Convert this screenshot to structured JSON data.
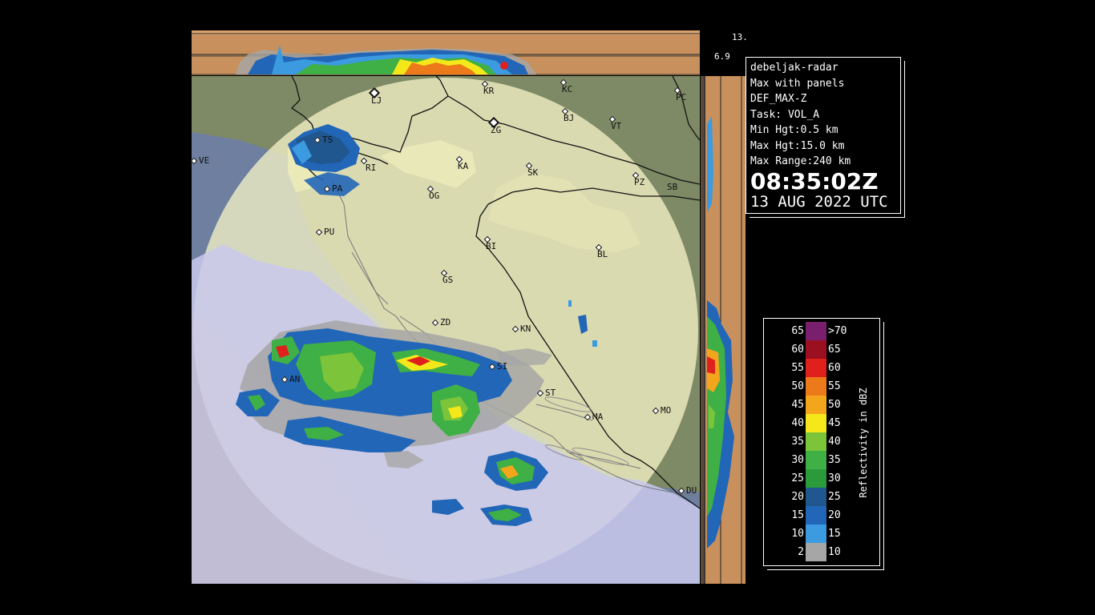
{
  "height_labels": {
    "top": "13.",
    "mid": "6.9"
  },
  "info": {
    "site": "debeljak-radar",
    "product": "Max with panels",
    "config": "DEF_MAX-Z",
    "task": "Task: VOL_A",
    "min_hgt": "Min Hgt:0.5 km",
    "max_hgt": "Max Hgt:15.0 km",
    "max_range": "Max Range:240 km",
    "time": "08:35:02Z",
    "date": "13 AUG 2022 UTC"
  },
  "legend": {
    "title": "Reflectivity in dBZ",
    "rows": [
      {
        "lo": "65",
        "hi": ">70",
        "color": "#7a1f6e"
      },
      {
        "lo": "60",
        "hi": "65",
        "color": "#9b1020"
      },
      {
        "lo": "55",
        "hi": "60",
        "color": "#e0201c"
      },
      {
        "lo": "50",
        "hi": "55",
        "color": "#ec7a1a"
      },
      {
        "lo": "45",
        "hi": "50",
        "color": "#f3a51c"
      },
      {
        "lo": "40",
        "hi": "45",
        "color": "#f4e81a"
      },
      {
        "lo": "35",
        "hi": "40",
        "color": "#7cc43a"
      },
      {
        "lo": "30",
        "hi": "35",
        "color": "#3fb045"
      },
      {
        "lo": "25",
        "hi": "30",
        "color": "#2b9a3a"
      },
      {
        "lo": "20",
        "hi": "25",
        "color": "#21578f"
      },
      {
        "lo": "15",
        "hi": "20",
        "color": "#2266b8"
      },
      {
        "lo": "10",
        "hi": "15",
        "color": "#3c9be0"
      },
      {
        "lo": "2",
        "hi": "10",
        "color": "#a6a6a6"
      }
    ]
  },
  "cities": [
    {
      "id": "lj",
      "label": "LJ",
      "big": true
    },
    {
      "id": "kr",
      "label": "KR"
    },
    {
      "id": "kc",
      "label": "KC"
    },
    {
      "id": "pc",
      "label": "PC"
    },
    {
      "id": "bj",
      "label": "BJ"
    },
    {
      "id": "vt",
      "label": "VT"
    },
    {
      "id": "zg",
      "label": "ZG",
      "big": true
    },
    {
      "id": "ts",
      "label": "TS"
    },
    {
      "id": "ve",
      "label": "VE"
    },
    {
      "id": "ri",
      "label": "RI"
    },
    {
      "id": "ka",
      "label": "KA"
    },
    {
      "id": "sk",
      "label": "SK"
    },
    {
      "id": "pz",
      "label": "PZ"
    },
    {
      "id": "sb",
      "label": "SB"
    },
    {
      "id": "pa",
      "label": "PA"
    },
    {
      "id": "og",
      "label": "OG"
    },
    {
      "id": "pu",
      "label": "PU"
    },
    {
      "id": "bi",
      "label": "BI"
    },
    {
      "id": "bl",
      "label": "BL"
    },
    {
      "id": "gs",
      "label": "GS"
    },
    {
      "id": "zd",
      "label": "ZD"
    },
    {
      "id": "kn",
      "label": "KN"
    },
    {
      "id": "si",
      "label": "SI"
    },
    {
      "id": "an",
      "label": "AN"
    },
    {
      "id": "st",
      "label": "ST"
    },
    {
      "id": "ma",
      "label": "MA"
    },
    {
      "id": "mo",
      "label": "MO"
    },
    {
      "id": "du",
      "label": "DU"
    }
  ]
}
